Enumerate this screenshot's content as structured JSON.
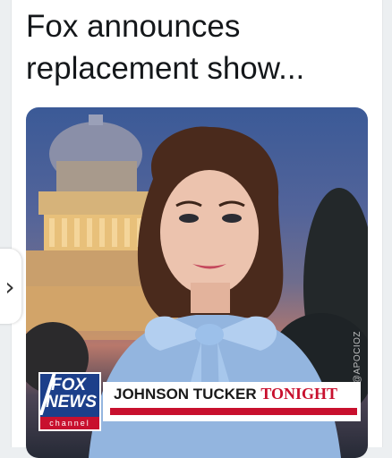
{
  "tweet": {
    "text_line1": "Fox announces",
    "text_line2": "replacement show..."
  },
  "media": {
    "watermark": "@APOCIOZ",
    "logo": {
      "fox": "FOX",
      "news": "NEWS",
      "channel": "channel"
    },
    "lower_third": {
      "show_name_main": "JOHNSON TUCKER",
      "show_name_accent": "TONIGHT"
    }
  },
  "navigation": {
    "next_arrow": "›"
  },
  "colors": {
    "fox_blue": "#1c3f8a",
    "fox_red": "#c8102e",
    "text": "#14171a"
  }
}
